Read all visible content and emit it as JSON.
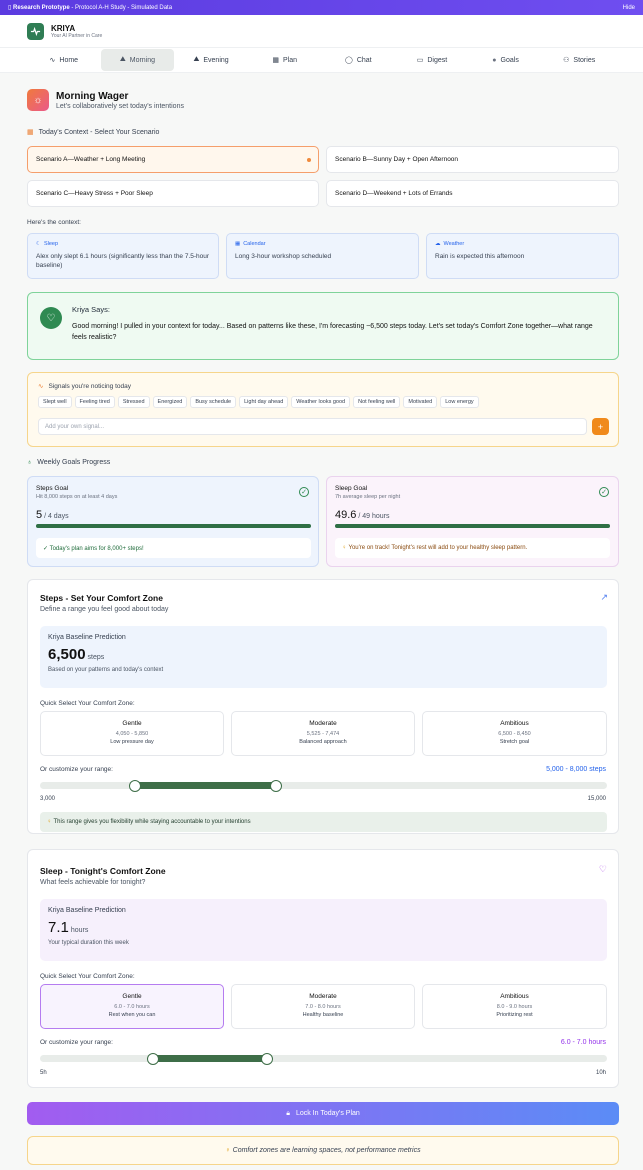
{
  "banner": {
    "title": "Research Prototype",
    "subtitle": " - Protocol A-H Study - Simulated Data",
    "hide": "Hide"
  },
  "app": {
    "name": "KRIYA",
    "tagline": "Your AI Partner in Care"
  },
  "tabs": [
    {
      "label": "Home"
    },
    {
      "label": "Morning"
    },
    {
      "label": "Evening"
    },
    {
      "label": "Plan"
    },
    {
      "label": "Chat"
    },
    {
      "label": "Digest"
    },
    {
      "label": "Goals"
    },
    {
      "label": "Stories"
    }
  ],
  "page": {
    "title": "Morning Wager",
    "subtitle": "Let's collaboratively set today's intentions"
  },
  "context": {
    "heading": "Today's Context - Select Your Scenario",
    "scenarios": [
      "Scenario A—Weather + Long Meeting",
      "Scenario B—Sunny Day + Open Afternoon",
      "Scenario C—Heavy Stress + Poor Sleep",
      "Scenario D—Weekend + Lots of Errands"
    ],
    "intro": "Here's the context:",
    "items": [
      {
        "title": "Sleep",
        "text": "Alex only slept 6.1 hours (significantly less than the 7.5-hour baseline)"
      },
      {
        "title": "Calendar",
        "text": "Long 3-hour workshop scheduled"
      },
      {
        "title": "Weather",
        "text": "Rain is expected this afternoon"
      }
    ]
  },
  "kriya": {
    "title": "Kriya Says:",
    "message": "Good morning! I pulled in your context for today... Based on patterns like these, I'm forecasting ~6,500 steps today. Let's set today's Comfort Zone together—what range feels realistic?"
  },
  "signals": {
    "heading": "Signals you're noticing today",
    "chips": [
      "Slept well",
      "Feeling tired",
      "Stressed",
      "Energized",
      "Busy schedule",
      "Light day ahead",
      "Weather looks good",
      "Not feeling well",
      "Motivated",
      "Low energy"
    ],
    "placeholder": "Add your own signal...",
    "add": "+"
  },
  "weekly": {
    "heading": "Weekly Goals Progress",
    "steps": {
      "title": "Steps Goal",
      "desc": "Hit 8,000 steps on at least 4 days",
      "value": "5",
      "unit": "/ 4 days",
      "progress": 1.0,
      "note": "✓ Today's plan aims for 8,000+ steps!"
    },
    "sleep": {
      "title": "Sleep Goal",
      "desc": "7h average sleep per night",
      "value": "49.6",
      "unit": "/ 49 hours",
      "progress": 1.0,
      "note": "You're on track! Tonight's rest will add to your healthy sleep pattern."
    }
  },
  "steps": {
    "title": "Steps - Set Your Comfort Zone",
    "subtitle": "Define a range you feel good about today",
    "pred_label": "Kriya Baseline Prediction",
    "pred_value": "6,500",
    "pred_unit": "steps",
    "pred_note": "Based on your patterns and today's context",
    "quick": "Quick Select Your Comfort Zone:",
    "zones": [
      {
        "name": "Gentle",
        "range": "4,050 - 5,850",
        "desc": "Low pressure day"
      },
      {
        "name": "Moderate",
        "range": "5,525 - 7,474",
        "desc": "Balanced approach"
      },
      {
        "name": "Ambitious",
        "range": "6,500 - 8,450",
        "desc": "Stretch goal"
      }
    ],
    "custom": "Or customize your range:",
    "range_text": "5,000 - 8,000 steps",
    "min": 3000,
    "max": 15000,
    "low": 5000,
    "high": 8000,
    "min_label": "3,000",
    "max_label": "15,000",
    "tip": "This range gives you flexibility while staying accountable to your intentions"
  },
  "sleep": {
    "title": "Sleep - Tonight's Comfort Zone",
    "subtitle": "What feels achievable for tonight?",
    "pred_label": "Kriya Baseline Prediction",
    "pred_value": "7.1",
    "pred_unit": "hours",
    "pred_note": "Your typical duration this week",
    "quick": "Quick Select Your Comfort Zone:",
    "zones": [
      {
        "name": "Gentle",
        "range": "6.0 - 7.0 hours",
        "desc": "Rest when you can"
      },
      {
        "name": "Moderate",
        "range": "7.0 - 8.0 hours",
        "desc": "Healthy baseline"
      },
      {
        "name": "Ambitious",
        "range": "8.0 - 9.0 hours",
        "desc": "Prioritizing rest"
      }
    ],
    "custom": "Or customize your range:",
    "range_text": "6.0 - 7.0 hours",
    "min": 5,
    "max": 10,
    "low": 6,
    "high": 7,
    "min_label": "5h",
    "max_label": "10h"
  },
  "lock": "Lock In Today's Plan",
  "footer": "Comfort zones are learning spaces, not performance metrics"
}
